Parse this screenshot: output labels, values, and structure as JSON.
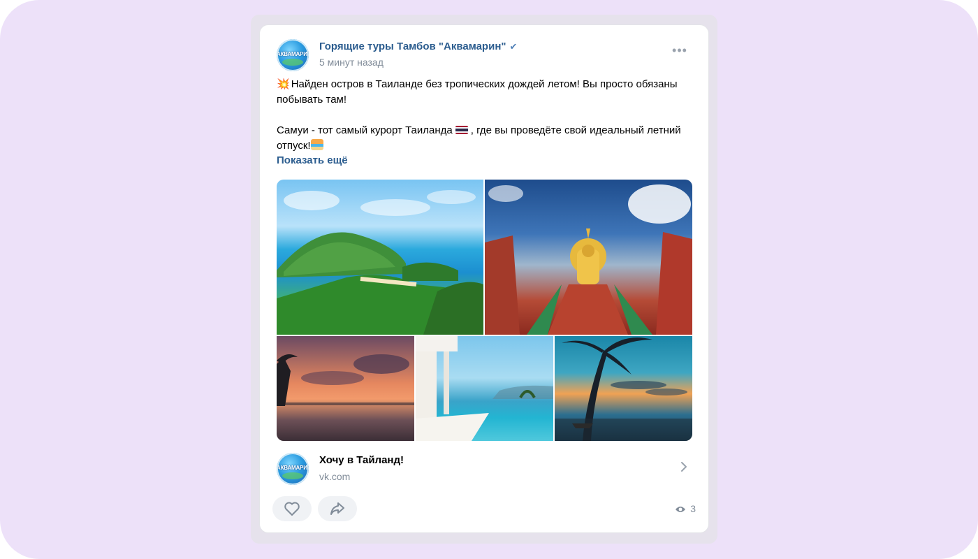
{
  "post": {
    "author": "Горящие туры Тамбов \"Аквамарин\"",
    "avatar_text": "АКВАМАРИН",
    "time": "5 минут назад",
    "text_line1": "Найден остров в Таиланде без тропических дождей летом! Вы просто обязаны побывать там!",
    "text_line2a": "Самуи - тот самый курорт Таиланда",
    "text_line2b": ", где вы проведёте свой идеальный летний отпуск!",
    "show_more": "Показать ещё"
  },
  "link": {
    "title": "Хочу в Тайланд!",
    "domain": "vk.com",
    "avatar_text": "АКВАМАРИН"
  },
  "footer": {
    "views": "3"
  },
  "colors": {
    "page_bg": "#ede1f9",
    "link_blue": "#2c5d8f",
    "secondary_text": "#818c99",
    "button_bg": "#f0f2f5"
  }
}
